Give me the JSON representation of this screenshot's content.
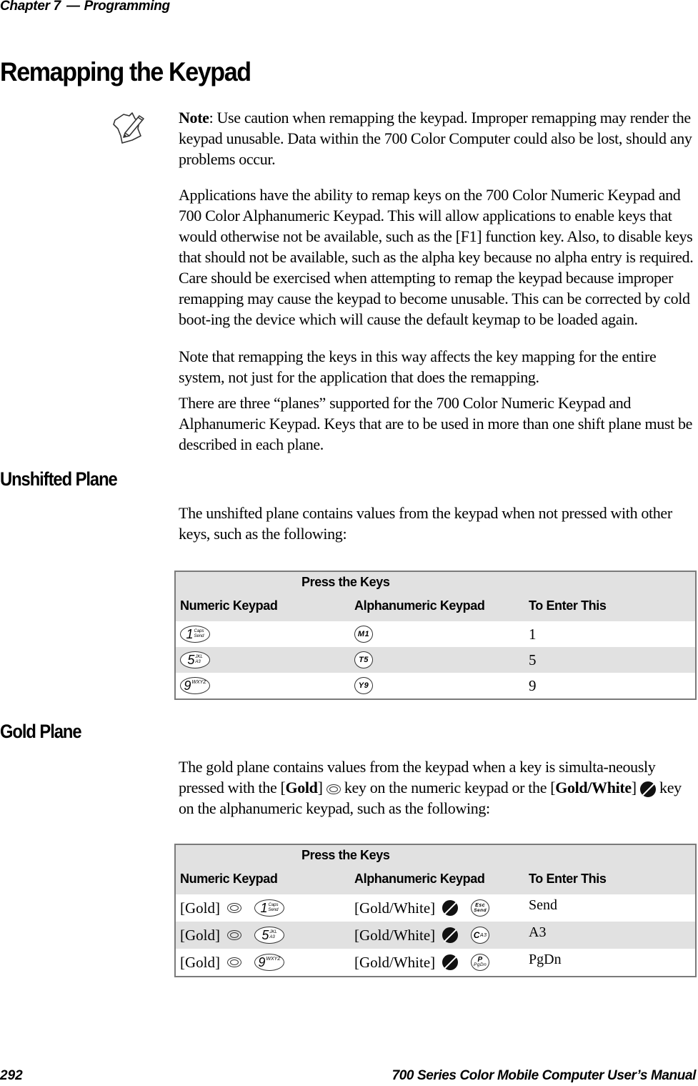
{
  "header": {
    "chapter": "Chapter 7",
    "dash": "—",
    "section": "Programming"
  },
  "title": "Remapping the Keypad",
  "note": {
    "label": "Note",
    "text": ": Use caution when remapping the keypad. Improper remapping may render the keypad unusable. Data within the 700 Color Computer could also be lost, should any problems occur.",
    "icon": "note-pencil-icon"
  },
  "paragraphs": [
    "Applications have the ability to remap keys on the 700 Color Numeric Keypad and 700 Color Alphanumeric Keypad. This will allow applications to enable keys that would otherwise not be available, such as the [F1] function key. Also, to disable keys that should not be available, such as the alpha key because no alpha entry is required. Care should be exercised when attempting to remap the keypad because improper remapping may cause the keypad to become unusable. This can be corrected by cold boot-ing the device which will cause the default keymap to be loaded again.",
    "Note that remapping the keys in this way affects the key mapping for the entire system, not just for the application that does the remapping.",
    "There are three “planes” supported for the 700 Color Numeric Keypad and Alphanumeric Keypad. Keys that are to be used in more than one shift plane must be described in each plane."
  ],
  "unshifted": {
    "heading": "Unshifted Plane",
    "intro": "The unshifted plane contains values from the keypad when not pressed with other keys, such as the following:",
    "table": {
      "group_header": "Press the Keys",
      "columns": [
        "Numeric Keypad",
        "Alphanumeric Keypad",
        "To Enter This"
      ],
      "rows": [
        {
          "numeric": {
            "main": "1",
            "sub1": "Caps",
            "sub2": "Send"
          },
          "alpha": "M1",
          "value": "1"
        },
        {
          "numeric": {
            "main": "5",
            "sub1": "JKL",
            "sub2": "A3"
          },
          "alpha": "T5",
          "value": "5"
        },
        {
          "numeric": {
            "main": "9",
            "sub1": "WXYZ",
            "sub2": ""
          },
          "alpha": "Y9",
          "value": "9"
        }
      ]
    }
  },
  "gold": {
    "heading": "Gold Plane",
    "intro_1": "The gold plane contains values from the keypad when a key is simulta-neously pressed with the [",
    "intro_gold": "Gold",
    "intro_2": "] ",
    "intro_3": " key on the numeric keypad or the [",
    "intro_gw": "Gold/White",
    "intro_4": "] ",
    "intro_5": " key on the alphanumeric keypad, such as the following:",
    "table": {
      "group_header": "Press the Keys",
      "columns": [
        "Numeric Keypad",
        "Alphanumeric Keypad",
        "To Enter This"
      ],
      "rows": [
        {
          "gold_label": "[Gold]",
          "numeric": {
            "main": "1",
            "sub1": "Caps",
            "sub2": "Send"
          },
          "gw_label": "[Gold/White]",
          "alpha": {
            "l1": "Esc",
            "l2": "Send"
          },
          "value": "Send"
        },
        {
          "gold_label": "[Gold]",
          "numeric": {
            "main": "5",
            "sub1": "JKL",
            "sub2": "A3"
          },
          "gw_label": "[Gold/White]",
          "alpha": {
            "l1": "C",
            "l2": "A3"
          },
          "value": "A3"
        },
        {
          "gold_label": "[Gold]",
          "numeric": {
            "main": "9",
            "sub1": "WXYZ",
            "sub2": ""
          },
          "gw_label": "[Gold/White]",
          "alpha": {
            "l1": "P",
            "l2": "PgDn"
          },
          "value": "PgDn"
        }
      ]
    }
  },
  "footer": {
    "page_number": "292",
    "manual_title": "700 Series Color Mobile Computer User’s Manual"
  }
}
